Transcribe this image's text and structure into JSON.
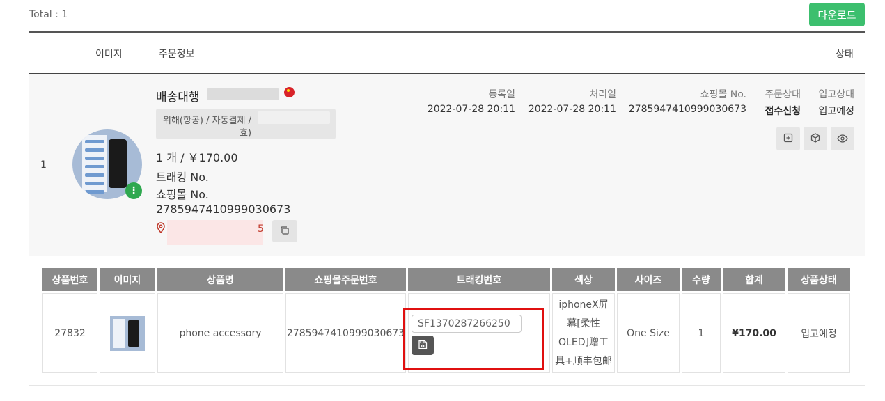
{
  "toolbar": {
    "total": "Total : 1",
    "download_label": "다운로드",
    "accent": "#3cbf6e"
  },
  "header": {
    "image": "이미지",
    "order_info": "주문정보",
    "status": "상태"
  },
  "order": {
    "index": "1",
    "service": "배송대행",
    "shipping_prefix": "위해(항공) / 자동결제 /",
    "shipping_suffix": "효)",
    "qty_price": "1 개 / ￥170.00",
    "tracking_label": "트래킹 No.",
    "mall_label": "쇼핑몰 No.",
    "mall_no": "2785947410999030673",
    "address_tail": "5",
    "reg_label": "등록일",
    "reg_date": "2022-07-28 20:11",
    "proc_label": "처리일",
    "proc_date": "2022-07-28 20:11",
    "mall_no_label": "쇼핑몰 No.",
    "mall_no_value": "2785947410999030673",
    "order_status_label": "주문상태",
    "order_status": "접수신청",
    "stock_status_label": "입고상태",
    "stock_status": "입고예정"
  },
  "items_table": {
    "headers": [
      "상품번호",
      "이미지",
      "상품명",
      "쇼핑몰주문번호",
      "트래킹번호",
      "색상",
      "사이즈",
      "수량",
      "합계",
      "상품상태"
    ],
    "row": {
      "product_no": "27832",
      "product_name": "phone accessory",
      "mall_order_no": "2785947410999030673",
      "tracking_value": "SF1370287266250",
      "color_lines": [
        "iphoneX屏",
        "幕[柔性",
        "OLED]赠工",
        "具+顺丰包邮"
      ],
      "size": "One Size",
      "quantity": "1",
      "total": "¥170.00",
      "item_status": "입고예정"
    }
  },
  "icons": [
    "more-vertical-icon",
    "location-pin-icon",
    "copy-icon",
    "plus-square-icon",
    "box-icon",
    "eye-icon",
    "save-icon"
  ],
  "colors": {
    "highlight": "#e01010",
    "link_red": "#c0392b"
  }
}
